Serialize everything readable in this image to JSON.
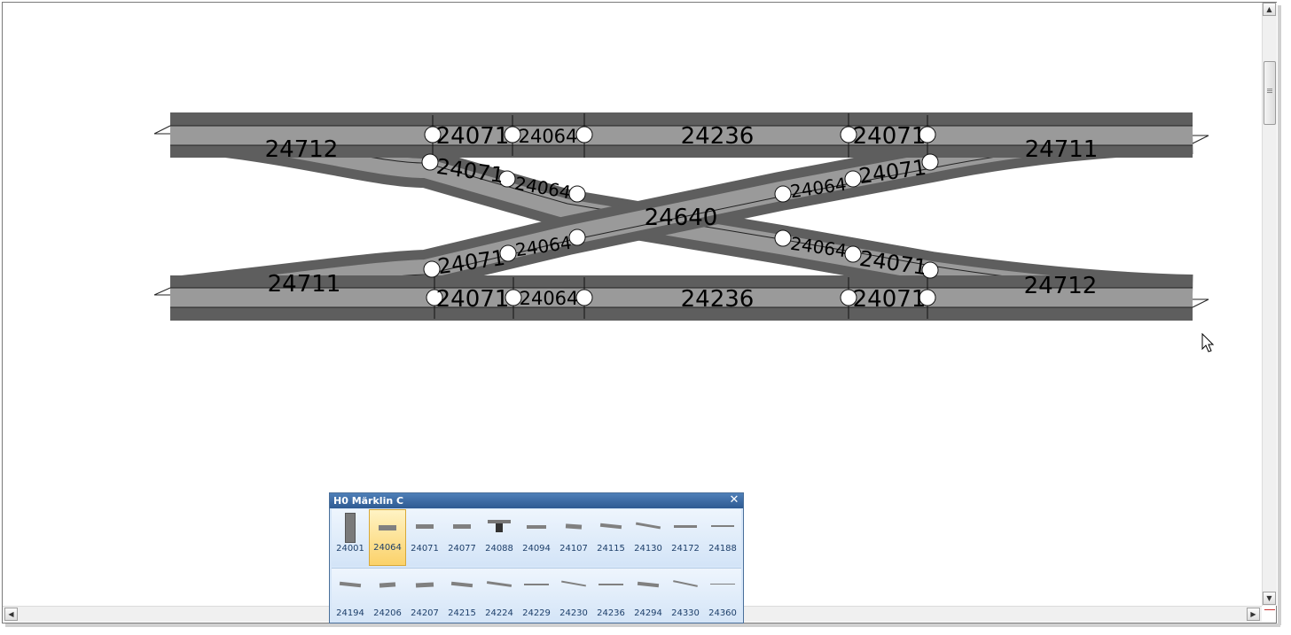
{
  "layout": {
    "top_left_main_label": "24712",
    "top_right_main_label": "24711",
    "bottom_left_main_label": "24711",
    "bottom_right_main_label": "24712",
    "center_label": "24640",
    "top_row": {
      "l1": "24071",
      "l2": "24064",
      "mid": "24236",
      "r1": "24071"
    },
    "bottom_row": {
      "l1": "24071",
      "l2": "24064",
      "mid": "24236",
      "r1": "24071"
    },
    "diag_upper": {
      "l1": "24071",
      "l2": "24064",
      "r2": "24064",
      "r1": "24071"
    },
    "diag_lower": {
      "l1": "24071",
      "l2": "24064",
      "r2": "24064",
      "r1": "24071"
    }
  },
  "palette": {
    "title": "H0 Märklin C",
    "close_label": "✕",
    "selected": "24064",
    "row1": [
      "24001",
      "24064",
      "24071",
      "24077",
      "24088",
      "24094",
      "24107",
      "24115",
      "24130",
      "24172",
      "24188"
    ],
    "row2": [
      "24194",
      "24206",
      "24207",
      "24215",
      "24224",
      "24229",
      "24230",
      "24236",
      "24294",
      "24330",
      "24360"
    ]
  },
  "scrollbar": {
    "up_arrow": "▲",
    "down_arrow": "▼",
    "left_arrow": "◀",
    "right_arrow": "▶"
  },
  "colors": {
    "track_dark": "#5e5e5e",
    "track_light": "#9a9a9a",
    "palette_title": "#2e5a92",
    "selected_tile": "#fbd26a"
  }
}
